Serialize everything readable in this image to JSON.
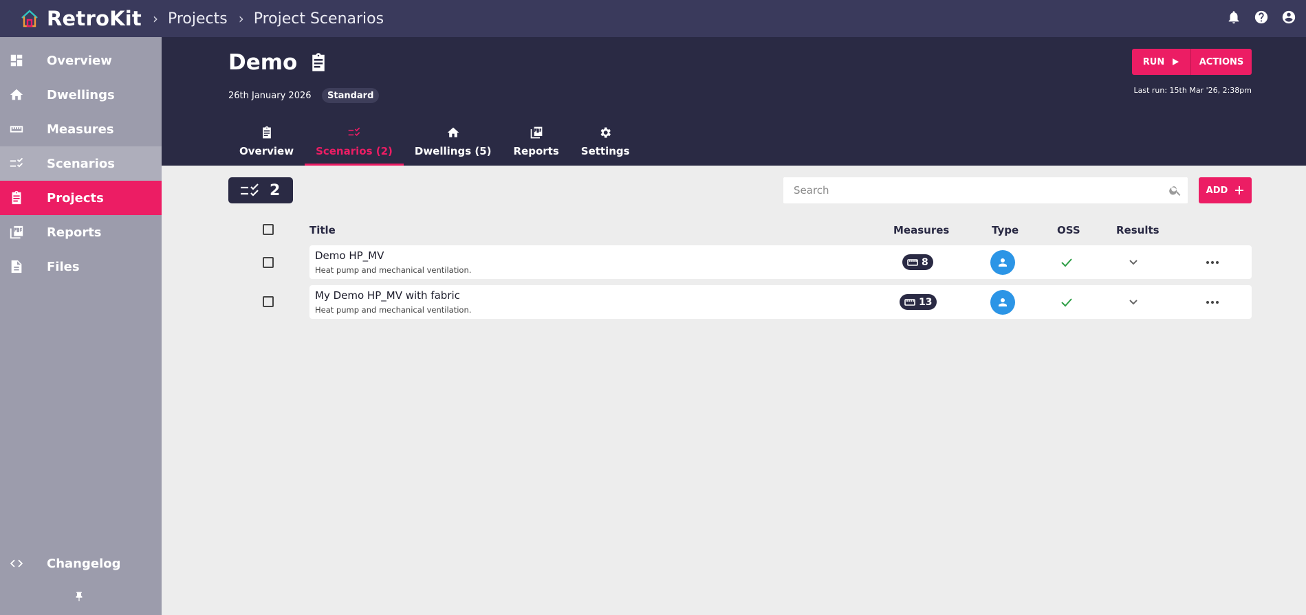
{
  "app": {
    "name": "RetroKit",
    "breadcrumbs": [
      "Projects",
      "Project Scenarios"
    ],
    "top_icons": [
      "bell-icon",
      "help-icon",
      "account-icon"
    ]
  },
  "sidebar": {
    "items": [
      {
        "label": "Overview",
        "icon": "dashboard-icon"
      },
      {
        "label": "Dwellings",
        "icon": "home-icon"
      },
      {
        "label": "Measures",
        "icon": "ruler-icon"
      },
      {
        "label": "Scenarios",
        "icon": "checklist-icon"
      },
      {
        "label": "Projects",
        "icon": "clipboard-icon",
        "active": true
      },
      {
        "label": "Reports",
        "icon": "pdf-icon"
      },
      {
        "label": "Files",
        "icon": "file-icon"
      }
    ],
    "changelog": {
      "label": "Changelog",
      "icon": "code-icon"
    },
    "pin_icon": "pin-icon"
  },
  "project": {
    "title": "Demo",
    "date": "26th January 2026",
    "badge": "Standard",
    "run_label": "RUN",
    "actions_label": "ACTIONS",
    "last_run": "Last run: 15th Mar '26, 2:38pm"
  },
  "tabs": [
    {
      "label": "Overview",
      "icon": "clipboard-icon"
    },
    {
      "label": "Scenarios (2)",
      "icon": "checklist-icon",
      "active": true
    },
    {
      "label": "Dwellings (5)",
      "icon": "home-icon"
    },
    {
      "label": "Reports",
      "icon": "pdf-icon"
    },
    {
      "label": "Settings",
      "icon": "gear-icon"
    }
  ],
  "toolbar": {
    "count": "2",
    "search_placeholder": "Search",
    "add_label": "ADD"
  },
  "table": {
    "headers": {
      "title": "Title",
      "measures": "Measures",
      "type": "Type",
      "oss": "OSS",
      "results": "Results"
    },
    "rows": [
      {
        "title": "Demo HP_MV",
        "description": "Heat pump and mechanical ventilation.",
        "measures": "8",
        "type": "user",
        "oss": true
      },
      {
        "title": "My Demo HP_MV with fabric",
        "description": "Heat pump and mechanical ventilation.",
        "measures": "13",
        "type": "user",
        "oss": true
      }
    ]
  },
  "colors": {
    "accent": "#ec1d64",
    "header_bg": "#2a2a44",
    "topbar_bg": "#3a3a5c",
    "sidebar_bg": "#9c9cac",
    "avatar_blue": "#2c95e6",
    "check_green": "#2e9e46"
  }
}
